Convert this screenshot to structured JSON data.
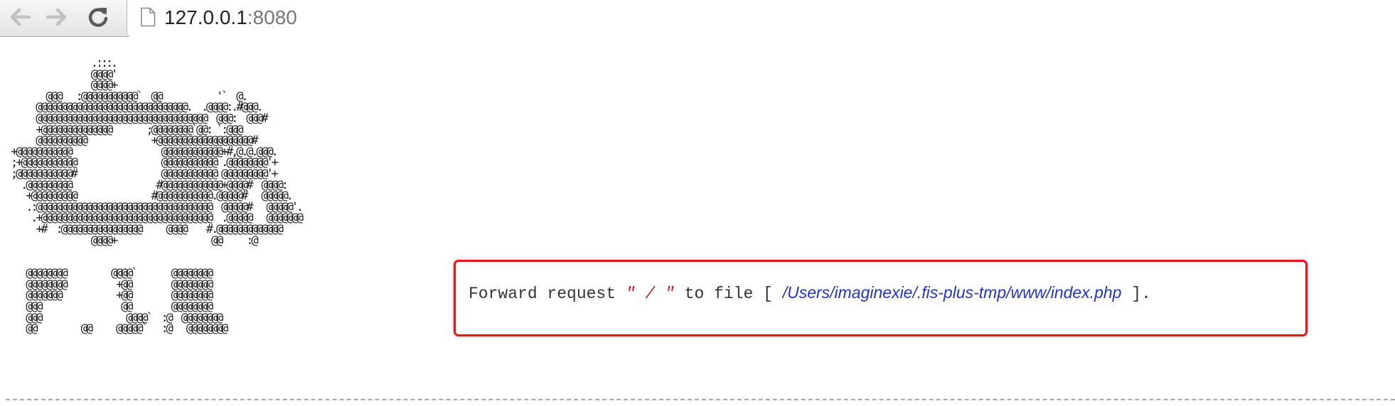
{
  "browser": {
    "back_icon": "arrow-left-icon",
    "forward_icon": "arrow-right-icon",
    "reload_icon": "reload-icon",
    "page_icon": "page-icon",
    "url_host": "127.0.0.1",
    "url_port": ":8080"
  },
  "ascii_art": "                 .:::.\n                 @@@@'\n                 @@@@+\n        @@@   :@@@@@@@@@@@`  @@           '`  @.\n      @@@@@@@@@@@@@@@@@@@@@@@@@@@@@@.  .@@@@:.#@@@.\n      @@@@@@@@@@@@@@@@@@@@@@@@@@@@@@@@@@  @@@:  @@@#\n      +@@@@@@@@@@@@@@       ;@@@@@@@@`@@: `:@@@\n      @@@@@@@@@@             +@@@@@@@@@@@@@@@@@@@#\n +@@@@@@@@@@@                  @@@@@@@@@@@@+#,@.@.@@@.\n ;+@@@@@@@@@@@                 @@@@@@@@@@@ .@@@@@@@@'+\n ;@@@@@@@@@@@#                 @@@@@@@@@@@ @@@@@@@@@'+\n   .@@@@@@@@@                 #@@@@@@@@@@@@+@@@@#  @@@@:\n    +@@@@@@@@@               #@@@@@@@@@@@.@@@@@#   @@@@@.\n    .:@@@@@@@@@@@@@@@@@@@@@@@@@@@@@@@@@@@  @@@@@#   @@@@@'.\n     .+@@@@@@@@@@@@@@@@@@@@@@@@@@@@@@@@@@  .@@@@@   @@@@@@@\n      +#  :@@@@@@@@@@@@@@@@     @@@@    #.@@@@@@@@@@@@@\n                 @@@@+                   @@     :@\n\n\n    @@@@@@@@         @@@@`       @@@@@@@@\n    @@@@@@@@          +@@        @@@@@@@@\n    @@@@@@@           +@@        @@@@@@@@\n    @@@                @@        @@@@@@@@\n    @@@                 @@@@`  :@  @@@@@@@@\n    @@         @@     @@@@@`   :@   @@@@@@@@",
  "message": {
    "prefix": "Forward request ",
    "request_path": "\" / \"",
    "middle": " to file [ ",
    "file_path": "/Users/imaginexie/.fis-plus-tmp/www/index.php",
    "suffix": " ]."
  },
  "colors": {
    "box_border": "#e8161b",
    "request_path": "#d0181c",
    "file_path": "#2233cc"
  }
}
